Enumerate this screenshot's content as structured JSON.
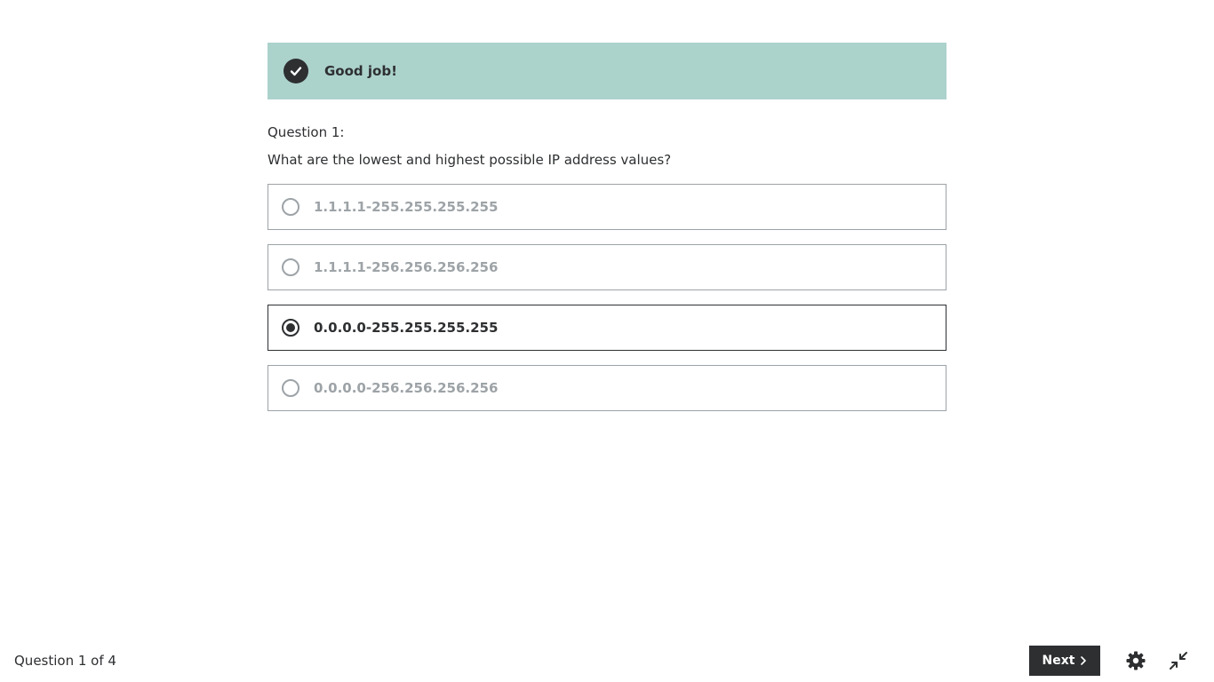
{
  "feedback": {
    "icon": "checkmark-icon",
    "message": "Good job!",
    "background_color": "#acd2cc"
  },
  "question": {
    "number_label": "Question 1:",
    "prompt": "What are the lowest and highest possible IP address values?"
  },
  "options": [
    {
      "label": "1.1.1.1-255.255.255.255",
      "selected": false
    },
    {
      "label": "1.1.1.1-256.256.256.256",
      "selected": false
    },
    {
      "label": "0.0.0.0-255.255.255.255",
      "selected": true
    },
    {
      "label": "0.0.0.0-256.256.256.256",
      "selected": false
    }
  ],
  "footer": {
    "progress_text": "Question 1 of 4",
    "next_label": "Next",
    "next_icon": "chevron-right-icon",
    "settings_icon": "gear-icon",
    "exit_fullscreen_icon": "compress-icon"
  },
  "colors": {
    "text": "#2d2f31",
    "muted": "#9da3a7",
    "accent_dark": "#2d2f31"
  }
}
